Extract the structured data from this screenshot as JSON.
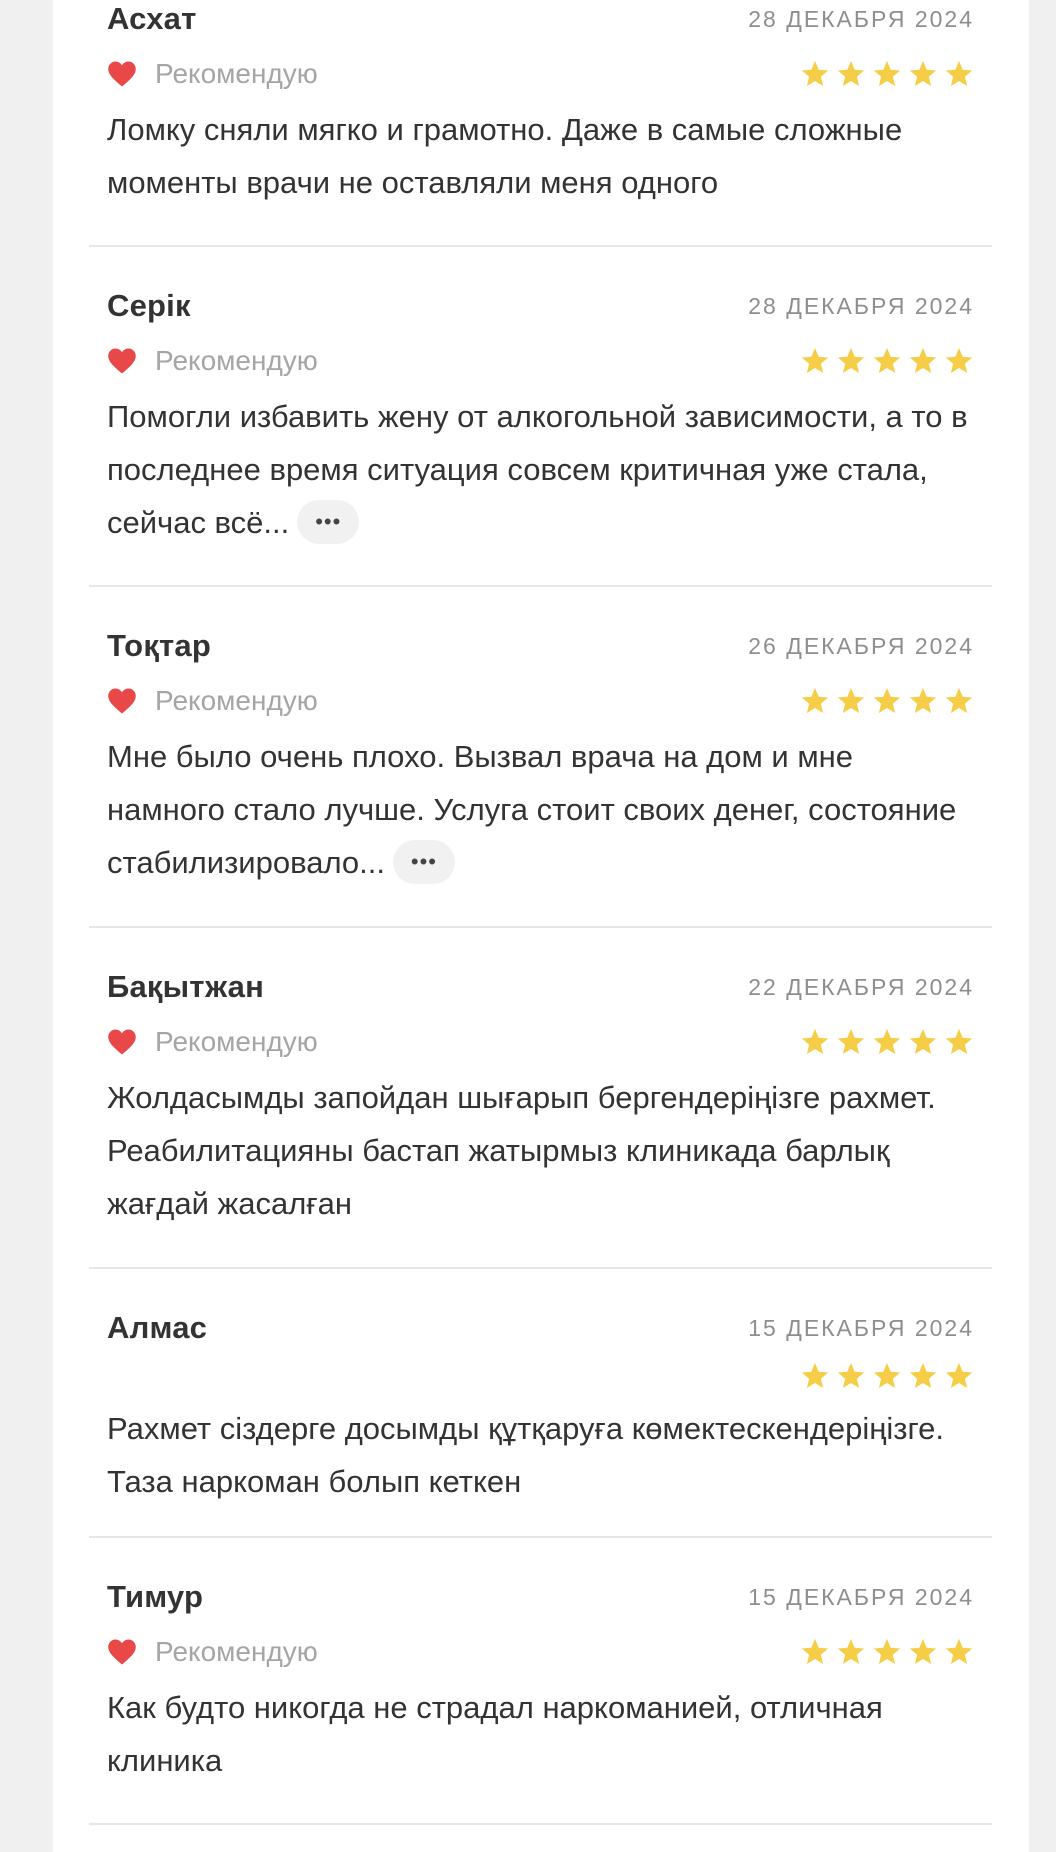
{
  "recommend_label": "Рекомендую",
  "more_label": "•••",
  "star_color": "#f5cd47",
  "heart_color": "#e84848",
  "reviews": [
    {
      "name": "Асхат",
      "date": "28 ДЕКАБРЯ 2024",
      "recommended": true,
      "rating": 5,
      "text": "Ломку сняли мягко и грамотно. Даже в самые сложные моменты врачи не оставляли меня одного",
      "truncated": false
    },
    {
      "name": "Серік",
      "date": "28 ДЕКАБРЯ 2024",
      "recommended": true,
      "rating": 5,
      "text": "Помогли избавить жену от алкогольной зависимости, а то в последнее время ситуация совсем критичная уже стала, сейчас всё...",
      "truncated": true
    },
    {
      "name": "Тоқтар",
      "date": "26 ДЕКАБРЯ 2024",
      "recommended": true,
      "rating": 5,
      "text": "Мне было очень плохо. Вызвал врача на дом и мне намного стало лучше. Услуга стоит своих денег, состояние стабилизировало...",
      "truncated": true
    },
    {
      "name": "Бақытжан",
      "date": "22 ДЕКАБРЯ 2024",
      "recommended": true,
      "rating": 5,
      "text": "Жолдасымды запойдан шығарып бергендеріңізге рахмет. Реабилитацияны бастап жатырмыз клиникада барлық жағдай жасалған",
      "truncated": false
    },
    {
      "name": "Алмас",
      "date": "15 ДЕКАБРЯ 2024",
      "recommended": false,
      "rating": 5,
      "text": "Рахмет сіздерге досымды құтқаруға көмектескендеріңізге. Таза наркоман болып кеткен",
      "truncated": false
    },
    {
      "name": "Тимур",
      "date": "15 ДЕКАБРЯ 2024",
      "recommended": true,
      "rating": 5,
      "text": "Как будто никогда не страдал наркоманией, отличная клиника",
      "truncated": false
    }
  ]
}
